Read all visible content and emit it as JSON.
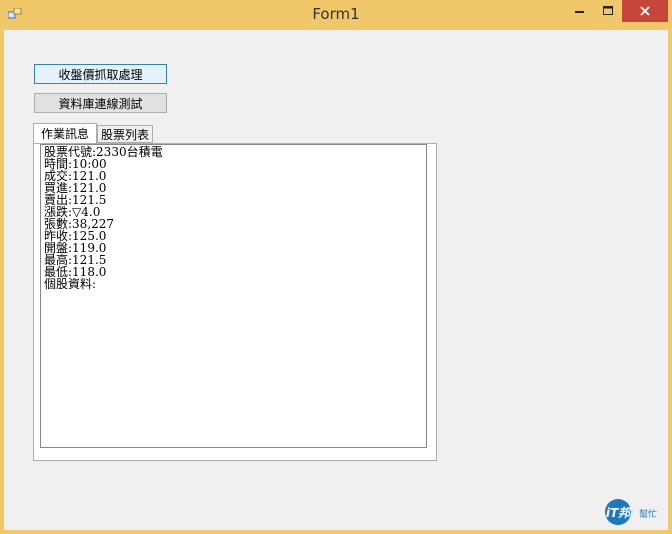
{
  "window": {
    "title": "Form1"
  },
  "buttons": {
    "fetch_close": "收盤價抓取處理",
    "db_test": "資料庫連線測試"
  },
  "tabs": [
    {
      "label": "作業訊息"
    },
    {
      "label": "股票列表"
    }
  ],
  "messages": [
    "股票代號:2330台積電",
    "時間:10:00",
    "成交:121.0",
    "買進:121.0",
    "賣出:121.5",
    "漲跌:▽4.0",
    "張數:38,227",
    "昨收:125.0",
    "開盤:119.0",
    "最高:121.5",
    "最低:118.0",
    "個股資料:"
  ],
  "logo": {
    "text": "iT邦",
    "sub": "幫忙"
  },
  "colors": {
    "title_bar": "#f0c86a",
    "close_button": "#c7463c",
    "client": "#f0f0f0"
  }
}
